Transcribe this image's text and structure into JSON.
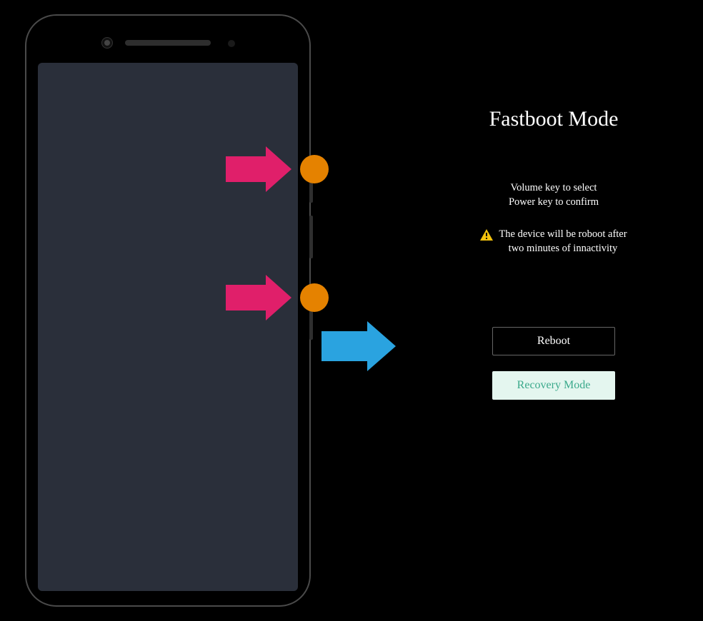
{
  "fastboot": {
    "title": "Fastboot Mode",
    "instructions_line1": "Volume key to select",
    "instructions_line2": "Power key to confirm",
    "warning_line1": "The device will be roboot after",
    "warning_line2": "two minutes of innactivity",
    "buttons": {
      "reboot": "Reboot",
      "recovery": "Recovery Mode"
    }
  },
  "annotations": {
    "pink_arrow_1": "press-volume-up",
    "pink_arrow_2": "press-power",
    "blue_arrow": "result-fastboot-screen",
    "dot_1": "volume-up-target",
    "dot_2": "power-target"
  },
  "colors": {
    "pink": "#e01f6a",
    "blue": "#2aa3e0",
    "orange": "#e58200",
    "screen": "#2a2f3a",
    "selected_bg": "#e4f6ef",
    "selected_text": "#3aa98b"
  }
}
